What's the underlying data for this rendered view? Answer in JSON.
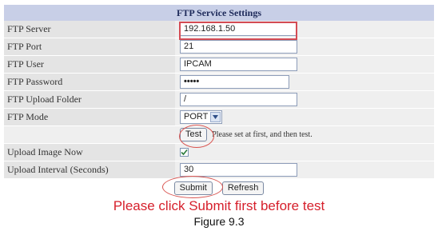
{
  "form": {
    "title": "FTP Service Settings",
    "ftp_server_label": "FTP Server",
    "ftp_server_value": "192.168.1.50",
    "ftp_port_label": "FTP Port",
    "ftp_port_value": "21",
    "ftp_user_label": "FTP User",
    "ftp_user_value": "IPCAM",
    "ftp_password_label": "FTP Password",
    "ftp_password_value": "•••••",
    "ftp_folder_label": "FTP Upload Folder",
    "ftp_folder_value": "/",
    "ftp_mode_label": "FTP Mode",
    "ftp_mode_value": "PORT",
    "test_button": "Test",
    "test_hint": "Please set at first, and then test.",
    "upload_now_label": "Upload Image Now",
    "upload_now_checked": true,
    "upload_interval_label": "Upload Interval (Seconds)",
    "upload_interval_value": "30",
    "submit_button": "Submit",
    "refresh_button": "Refresh"
  },
  "annotation": {
    "note": "Please click Submit first before test",
    "caption": "Figure 9.3",
    "highlight_color": "#d44b54"
  }
}
